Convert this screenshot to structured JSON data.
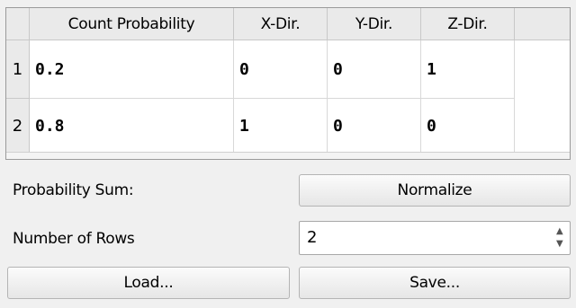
{
  "table": {
    "columns": [
      "Count Probability",
      "X-Dir.",
      "Y-Dir.",
      "Z-Dir."
    ],
    "rows": [
      {
        "index": "1",
        "cells": [
          "0.2",
          "0",
          "0",
          "1"
        ]
      },
      {
        "index": "2",
        "cells": [
          "0.8",
          "1",
          "0",
          "0"
        ]
      }
    ]
  },
  "controls": {
    "probability_sum_label": "Probability Sum:",
    "normalize_label": "Normalize",
    "number_of_rows_label": "Number of Rows",
    "number_of_rows_value": "2",
    "load_label": "Load...",
    "save_label": "Save..."
  },
  "icons": {
    "spin_up": "chevron-up-icon",
    "spin_down": "chevron-down-icon"
  }
}
